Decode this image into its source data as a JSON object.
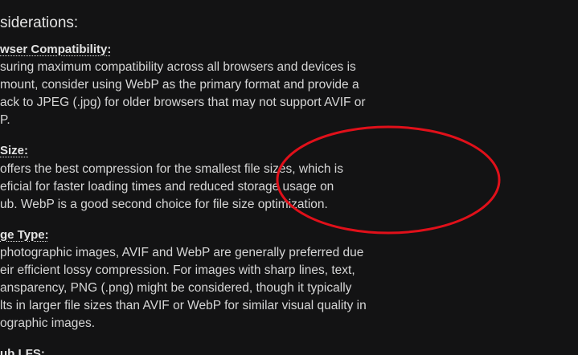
{
  "heading": "siderations:",
  "sections": [
    {
      "title": "wser Compatibility:",
      "lines": [
        "suring maximum compatibility across all browsers and devices is",
        "mount, consider using WebP as the primary format and provide a",
        "ack to JPEG (.jpg) for older browsers that may not support AVIF or",
        "P."
      ]
    },
    {
      "title": "Size:",
      "lines": [
        " offers the best compression for the smallest file sizes, which is",
        "eficial for faster loading times and reduced storage usage on",
        "ub. WebP is a good second choice for file size optimization."
      ]
    },
    {
      "title": "ge Type:",
      "lines": [
        "photographic images, AVIF and WebP are generally preferred due",
        "eir efficient lossy compression. For images with sharp lines, text,",
        "ansparency, PNG (.png) might be considered, though it typically",
        "lts in larger file sizes than AVIF or WebP for similar visual quality in",
        "ographic images."
      ]
    },
    {
      "title": "ub LFS:"
    }
  ],
  "annotation": {
    "shape": "ellipse-outline",
    "color": "#e0101a"
  }
}
